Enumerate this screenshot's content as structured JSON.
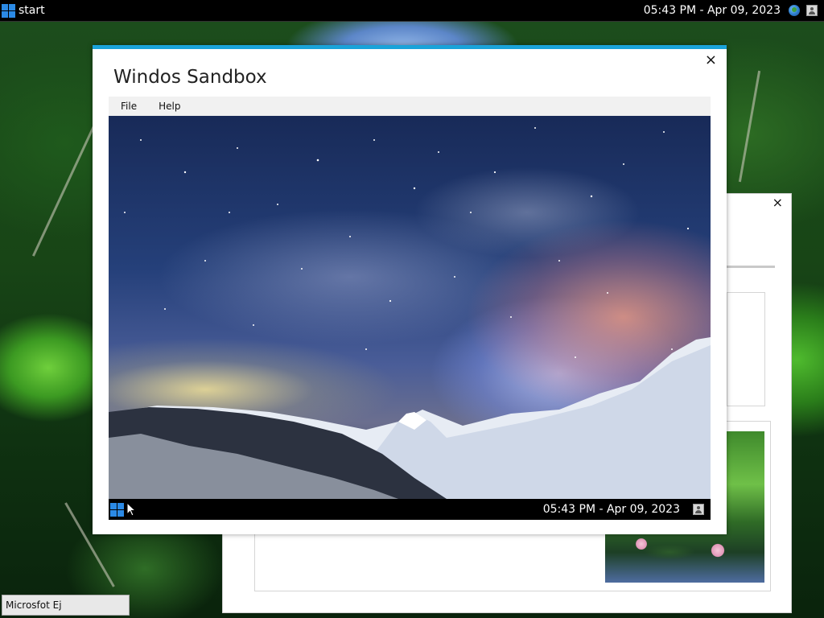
{
  "taskbar": {
    "start_label": "start",
    "clock": "05:43 PM - Apr 09, 2023",
    "icons": [
      "windows-logo-icon",
      "globe-icon",
      "user-icon"
    ]
  },
  "sandbox_window": {
    "title": "Windos Sandbox",
    "close_label": "×",
    "menu": [
      "File",
      "Help"
    ],
    "vm": {
      "clock": "05:43 PM - Apr 09, 2023",
      "icons": [
        "windows-logo-icon",
        "user-icon"
      ]
    },
    "accent_color": "#1aa3d9"
  },
  "background_window": {
    "close_label": "×"
  },
  "minimized_window": {
    "label": "Microsfot Ej"
  }
}
